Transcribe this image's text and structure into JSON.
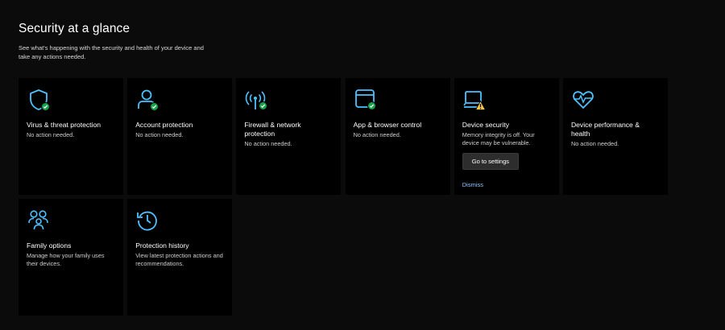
{
  "header": {
    "title": "Security at a glance",
    "subtitle": "See what's happening with the security and health of your device and take any actions needed."
  },
  "tiles": [
    {
      "id": "virus",
      "icon": "shield-icon",
      "title": "Virus & threat protection",
      "status": "No action needed."
    },
    {
      "id": "account",
      "icon": "person-icon",
      "title": "Account protection",
      "status": "No action needed."
    },
    {
      "id": "firewall",
      "icon": "wireless-antenna-icon",
      "title": "Firewall & network protection",
      "status": "No action needed."
    },
    {
      "id": "app-browser",
      "icon": "browser-window-icon",
      "title": "App & browser control",
      "status": "No action needed."
    },
    {
      "id": "device-security",
      "icon": "laptop-icon",
      "title": "Device security",
      "status": "Memory integrity is off. Your device may be vulnerable.",
      "button": "Go to settings",
      "link": "Dismiss"
    },
    {
      "id": "performance",
      "icon": "heartbeat-icon",
      "title": "Device performance & health",
      "status": "No action needed."
    },
    {
      "id": "family",
      "icon": "family-icon",
      "title": "Family options",
      "status": "Manage how your family uses their devices."
    },
    {
      "id": "history",
      "icon": "history-icon",
      "title": "Protection history",
      "status": "View latest protection actions and recommendations."
    }
  ],
  "colors": {
    "accent": "#4cc2ff",
    "ok_badge": "#16a34a",
    "warning": "#f7c948",
    "link": "#8fc8ff",
    "tile_bg": "#000000",
    "page_bg": "#0b0b0b"
  }
}
